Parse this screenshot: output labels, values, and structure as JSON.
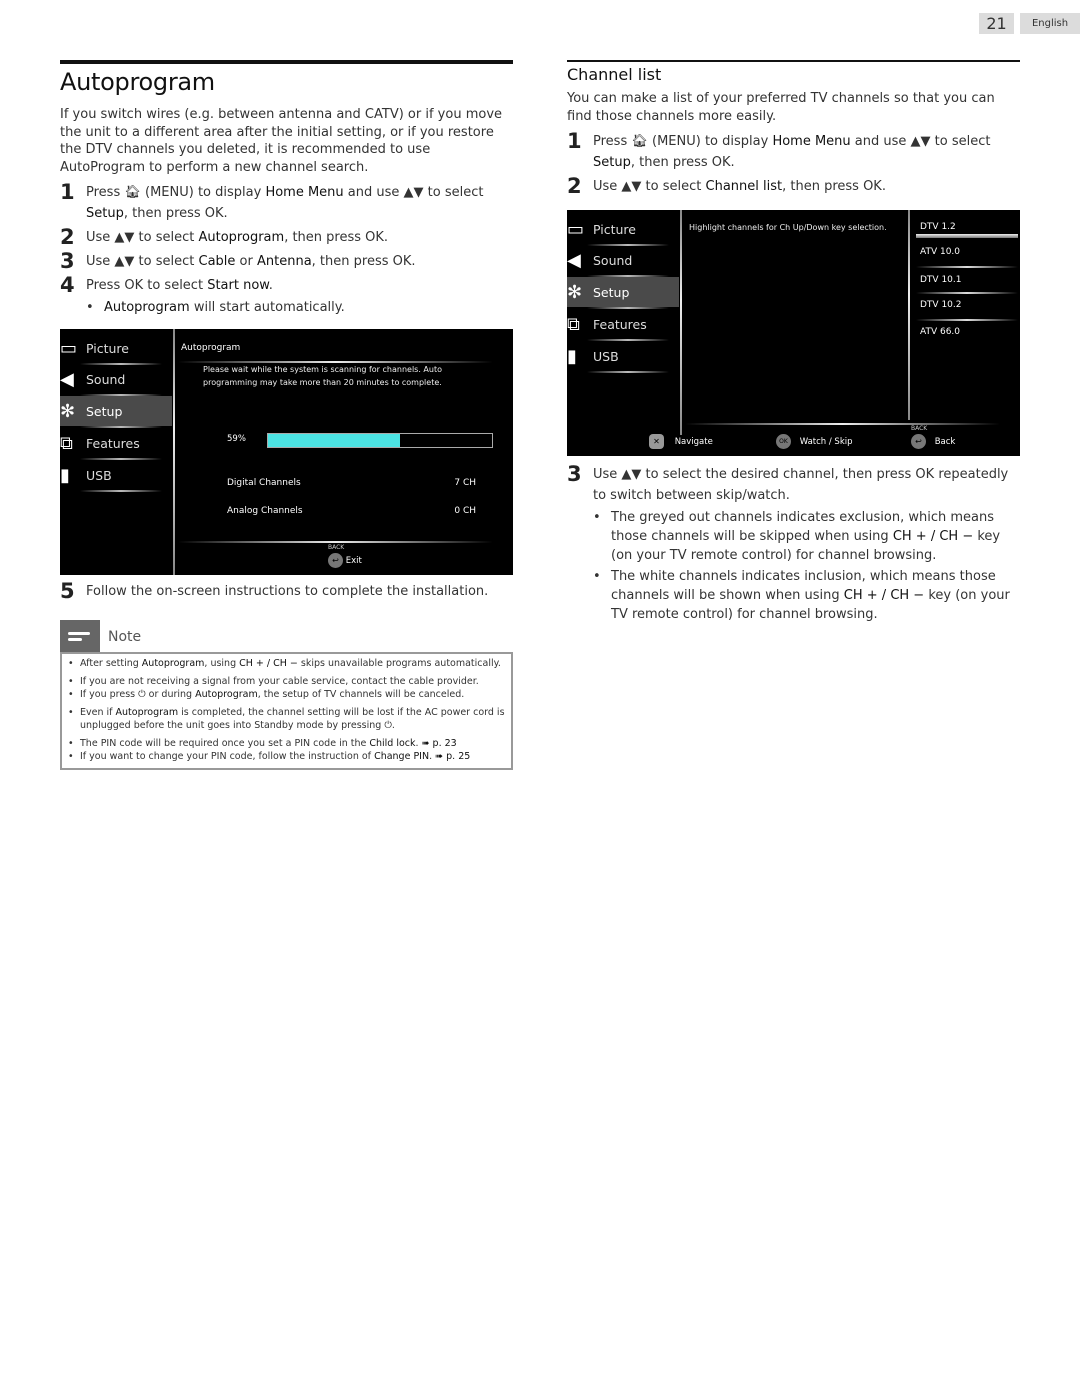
{
  "header": {
    "page_number": "21",
    "language": "English"
  },
  "autoprogram": {
    "title": "Autoprogram",
    "intro": "If you switch wires (e.g. between antenna and CATV) or if you move the unit to a different area after the initial setting, or if you restore the DTV channels you deleted, it is recommended to use AutoProgram to perform a new channel search.",
    "steps": [
      {
        "num": "1",
        "parts": [
          "Press ",
          "(MENU) to display ",
          "Home Menu",
          " and use ▲▼ to select ",
          "Setup",
          ", then press OK."
        ]
      },
      {
        "num": "2",
        "parts": [
          "Use ▲▼ to select ",
          "Autoprogram",
          ", then press OK."
        ]
      },
      {
        "num": "3",
        "parts": [
          "Use ▲▼ to select ",
          "Cable",
          " or ",
          "Antenna",
          ", then press OK."
        ]
      },
      {
        "num": "4",
        "parts": [
          "Press OK to select ",
          "Start now",
          "."
        ]
      },
      {
        "num": "5",
        "parts": [
          "Follow the on-screen instructions to complete the installation."
        ]
      }
    ],
    "step4_bullet": {
      "bold": "Autoprogram",
      "rest": " will start automatically."
    },
    "screen": {
      "menu": [
        "Picture",
        "Sound",
        "Setup",
        "Features",
        "USB"
      ],
      "active_menu": "Setup",
      "panel_title": "Autoprogram",
      "message": "Please wait while the system is scanning for channels. Auto programming may take more than 20 minutes to complete.",
      "progress_label": "59%",
      "progress_value": 0.59,
      "progress_color": "#4ce3e3",
      "rows": [
        {
          "label": "Digital Channels",
          "value": "7 CH"
        },
        {
          "label": "Analog Channels",
          "value": "0 CH"
        }
      ],
      "footer_key": "BACK",
      "footer_action": "Exit"
    },
    "note": {
      "label": "Note",
      "items": [
        {
          "parts": [
            "After setting ",
            "Autoprogram",
            ", using ",
            "CH + / CH −",
            " skips unavailable programs automatically."
          ]
        },
        {
          "parts": [
            "If you are not receiving a signal from your cable service, contact the cable provider."
          ]
        },
        {
          "parts": [
            "If you press ",
            "⏻",
            " or during ",
            "Autoprogram",
            ", the setup of TV channels will be canceled."
          ]
        },
        {
          "parts": [
            "Even if ",
            "Autoprogram",
            " is completed, the channel setting will be lost if the AC power cord is unplugged before the unit goes into Standby mode by pressing ",
            "⏻",
            "."
          ]
        },
        {
          "parts": [
            "The PIN code will be required once you set a PIN code in the ",
            "Child lock",
            ". ",
            "➠ p. 23"
          ]
        },
        {
          "parts": [
            "If you want to change your PIN code, follow the instruction of ",
            "Change PIN",
            ". ",
            "➠ p. 25"
          ]
        }
      ]
    }
  },
  "channel_list": {
    "title": "Channel list",
    "intro": "You can make a list of your preferred TV channels so that you can find those channels more easily.",
    "steps": [
      {
        "num": "1",
        "parts": [
          "Press ",
          "(MENU) to display ",
          "Home Menu",
          " and use ▲▼ to select ",
          "Setup",
          ", then press OK."
        ]
      },
      {
        "num": "2",
        "parts": [
          "Use ▲▼ to select ",
          "Channel list",
          ", then press OK."
        ]
      },
      {
        "num": "3",
        "parts": [
          "Use ▲▼ to select the desired channel, then press OK repeatedly to switch between skip/watch."
        ]
      }
    ],
    "bullets": [
      {
        "parts": [
          "The greyed out channels indicates exclusion, which means those channels will be skipped when using ",
          "CH + / CH −",
          " key (on your TV remote control) for channel browsing."
        ]
      },
      {
        "parts": [
          "The white channels indicates inclusion, which means those channels will be shown when using ",
          "CH + / CH −",
          " key (on your TV remote control) for channel browsing."
        ]
      }
    ],
    "screen": {
      "menu": [
        "Picture",
        "Sound",
        "Setup",
        "Features",
        "USB"
      ],
      "active_menu": "Setup",
      "hint": "Highlight channels for Ch Up/Down key selection.",
      "channels": [
        "DTV 1.2",
        "ATV 10.0",
        "DTV 10.1",
        "DTV 10.2",
        "ATV 66.0"
      ],
      "selected_channel": "DTV 1.2",
      "footer": [
        {
          "icon": "navigate-icon",
          "label": "Navigate"
        },
        {
          "icon": "ok-icon",
          "key": "OK",
          "label": "Watch / Skip"
        },
        {
          "icon": "back-icon",
          "key": "BACK",
          "label": "Back"
        }
      ]
    }
  },
  "icons": {
    "home": "home-icon",
    "picture": "picture-icon",
    "sound": "sound-icon",
    "setup": "gear-icon",
    "features": "features-icon",
    "usb": "usb-icon",
    "note": "note-icon"
  }
}
